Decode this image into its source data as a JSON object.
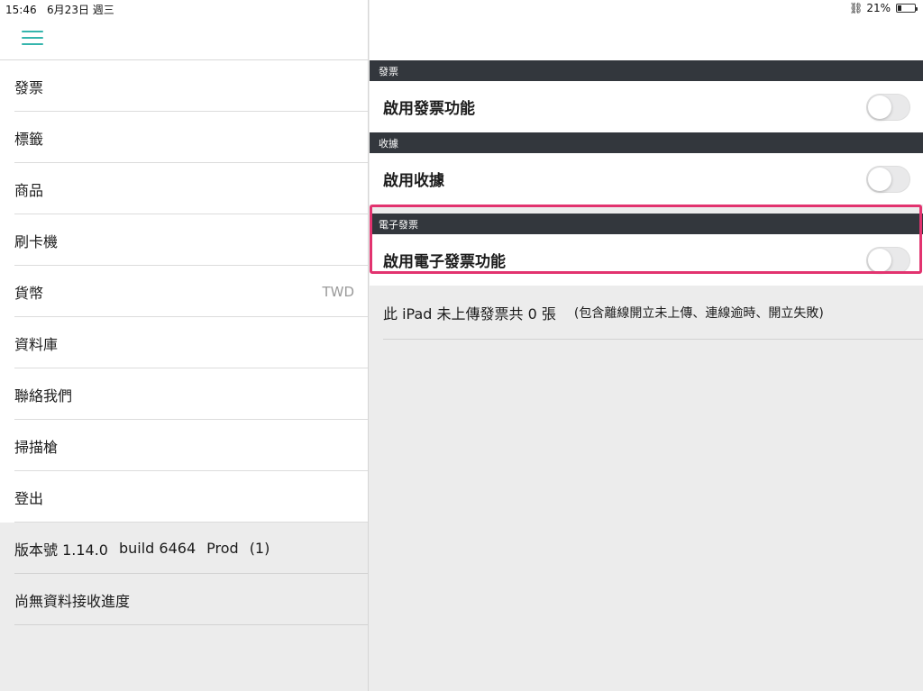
{
  "status_bar": {
    "time": "15:46",
    "date": "6月23日 週三",
    "battery": "21%",
    "battery_level": 0.21
  },
  "sidebar": {
    "menu_icon": "hamburger-icon",
    "items": [
      {
        "label": "發票",
        "value": ""
      },
      {
        "label": "標籤",
        "value": ""
      },
      {
        "label": "商品",
        "value": ""
      },
      {
        "label": "刷卡機",
        "value": ""
      },
      {
        "label": "貨幣",
        "value": "TWD"
      },
      {
        "label": "資料庫",
        "value": ""
      },
      {
        "label": "聯絡我們",
        "value": ""
      },
      {
        "label": "掃描槍",
        "value": ""
      },
      {
        "label": "登出",
        "value": ""
      }
    ],
    "version": {
      "label": "版本號 1.14.0",
      "build": "build 6464",
      "env": "Prod",
      "count": "(1)"
    },
    "sync_status": "尚無資料接收進度"
  },
  "content": {
    "sections": [
      {
        "header": "發票",
        "setting": "啟用發票功能",
        "enabled": false
      },
      {
        "header": "收據",
        "setting": "啟用收據",
        "enabled": false
      },
      {
        "header": "電子發票",
        "setting": "啟用電子發票功能",
        "enabled": false
      }
    ],
    "pending": {
      "main": "此 iPad 未上傳發票共 0 張",
      "note": "(包含離線開立未上傳、連線逾時、開立失敗)"
    }
  },
  "colors": {
    "accent": "#35b5ad",
    "section_header": "#33373d",
    "highlight": "#e2336f"
  }
}
